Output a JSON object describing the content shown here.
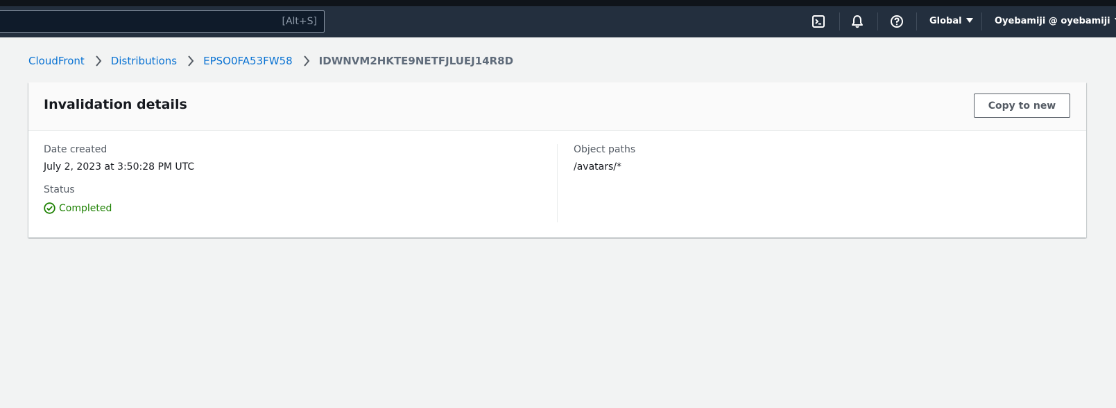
{
  "topnav": {
    "search_hint": "[Alt+S]",
    "icons": [
      "cloudshell-icon",
      "bell-icon",
      "help-icon"
    ],
    "region": "Global",
    "account": "Oyebamiji @ oyebamiji",
    "background": "#232f3e"
  },
  "breadcrumb": {
    "items": [
      "CloudFront",
      "Distributions",
      "EPSO0FA53FW58"
    ],
    "current": "IDWNVM2HKTE9NETFJLUEJ14R8D"
  },
  "card": {
    "title": "Invalidation details",
    "copy_button": "Copy to new",
    "date_created_label": "Date created",
    "date_created_value": "July 2, 2023 at 3:50:28 PM UTC",
    "status_label": "Status",
    "status_value": "Completed",
    "status_color": "#1d8102",
    "object_paths_label": "Object paths",
    "object_paths_value": "/avatars/*"
  }
}
